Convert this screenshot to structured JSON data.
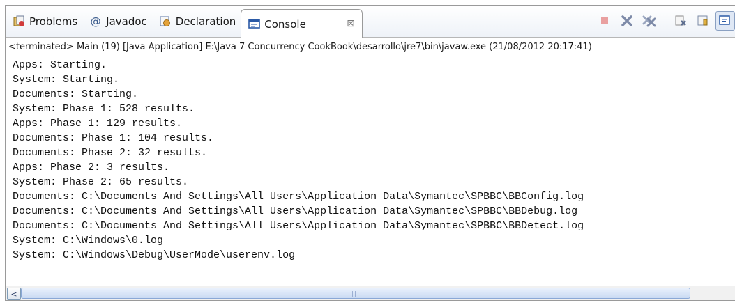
{
  "tabs": [
    {
      "label": "Problems",
      "icon": "problems-icon"
    },
    {
      "label": "Javadoc",
      "prefix": "@"
    },
    {
      "label": "Declaration",
      "icon": "declaration-icon"
    },
    {
      "label": "Console",
      "icon": "console-icon",
      "close": "⊠"
    }
  ],
  "status_line": "<terminated> Main (19) [Java Application] E:\\Java 7 Concurrency CookBook\\desarrollo\\jre7\\bin\\javaw.exe (21/08/2012 20:17:41)",
  "console_lines": [
    "Apps: Starting.",
    "System: Starting.",
    "Documents: Starting.",
    "System: Phase 1: 528 results.",
    "Apps: Phase 1: 129 results.",
    "Documents: Phase 1: 104 results.",
    "Documents: Phase 2: 32 results.",
    "Apps: Phase 2: 3 results.",
    "System: Phase 2: 65 results.",
    "Documents: C:\\Documents And Settings\\All Users\\Application Data\\Symantec\\SPBBC\\BBConfig.log",
    "Documents: C:\\Documents And Settings\\All Users\\Application Data\\Symantec\\SPBBC\\BBDebug.log",
    "Documents: C:\\Documents And Settings\\All Users\\Application Data\\Symantec\\SPBBC\\BBDetect.log",
    "System: C:\\Windows\\0.log",
    "System: C:\\Windows\\Debug\\UserMode\\userenv.log"
  ],
  "toolbar_icons": [
    "terminate-icon",
    "remove-launch-icon",
    "remove-all-terminated-icon",
    "clear-console-icon",
    "scroll-lock-icon",
    "pin-console-icon"
  ],
  "scrollbar": {
    "left_arrow": "<",
    "grip": "|||"
  },
  "colors": {
    "accent": "#2b5aa6",
    "terminate": "#c04040"
  }
}
